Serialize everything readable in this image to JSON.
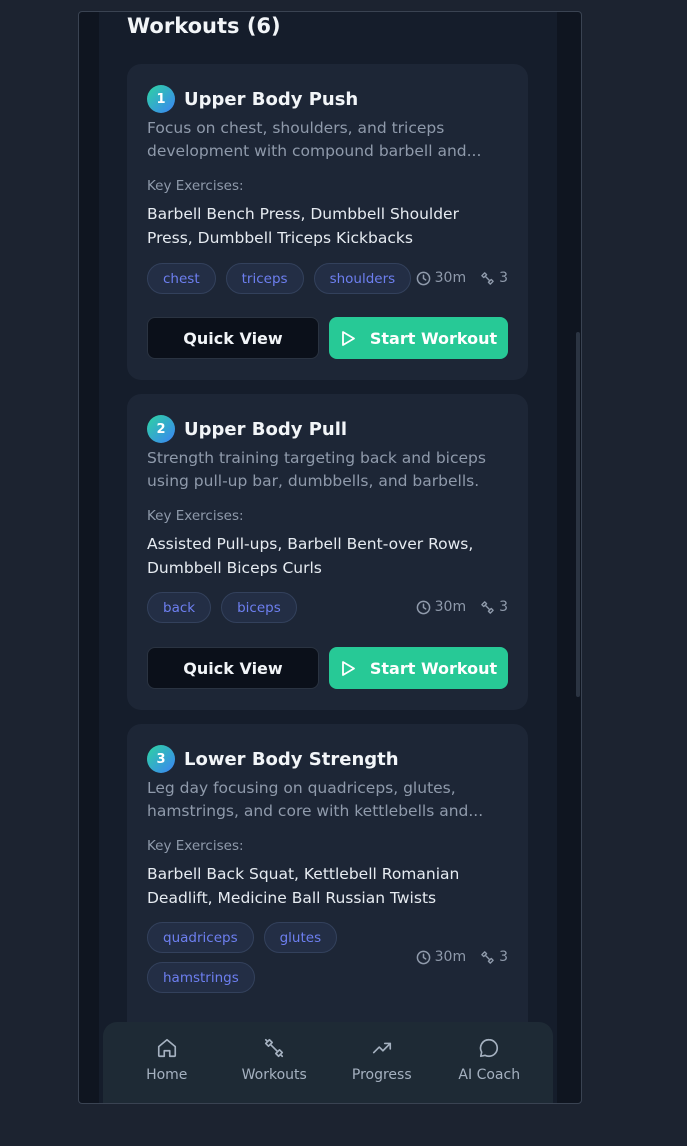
{
  "header": {
    "title": "Workouts (6)"
  },
  "labels": {
    "key_exercises": "Key Exercises:",
    "quick_view": "Quick View",
    "start_workout": "Start Workout"
  },
  "workouts": [
    {
      "number": "1",
      "title": "Upper Body Push",
      "description": "Focus on chest, shoulders, and triceps development with compound barbell and...",
      "key_exercises": "Barbell Bench Press, Dumbbell Shoulder Press, Dumbbell Triceps Kickbacks",
      "tags": [
        "chest",
        "triceps",
        "shoulders"
      ],
      "duration": "30m",
      "exercise_count": "3"
    },
    {
      "number": "2",
      "title": "Upper Body Pull",
      "description": "Strength training targeting back and biceps using pull-up bar, dumbbells, and barbells.",
      "key_exercises": "Assisted Pull-ups, Barbell Bent-over Rows, Dumbbell Biceps Curls",
      "tags": [
        "back",
        "biceps"
      ],
      "duration": "30m",
      "exercise_count": "3"
    },
    {
      "number": "3",
      "title": "Lower Body Strength",
      "description": "Leg day focusing on quadriceps, glutes, hamstrings, and core with kettlebells and...",
      "key_exercises": "Barbell Back Squat, Kettlebell Romanian Deadlift, Medicine Ball Russian Twists",
      "tags": [
        "quadriceps",
        "glutes",
        "hamstrings"
      ],
      "duration": "30m",
      "exercise_count": "3"
    }
  ],
  "nav": [
    {
      "label": "Home",
      "icon": "home-icon"
    },
    {
      "label": "Workouts",
      "icon": "dumbbell-icon"
    },
    {
      "label": "Progress",
      "icon": "trending-up-icon"
    },
    {
      "label": "AI Coach",
      "icon": "chat-bubble-icon"
    }
  ],
  "colors": {
    "accent": "#27c996",
    "tag_text": "#6d7ff0",
    "background": "#151d2b",
    "card": "#1d2636"
  }
}
